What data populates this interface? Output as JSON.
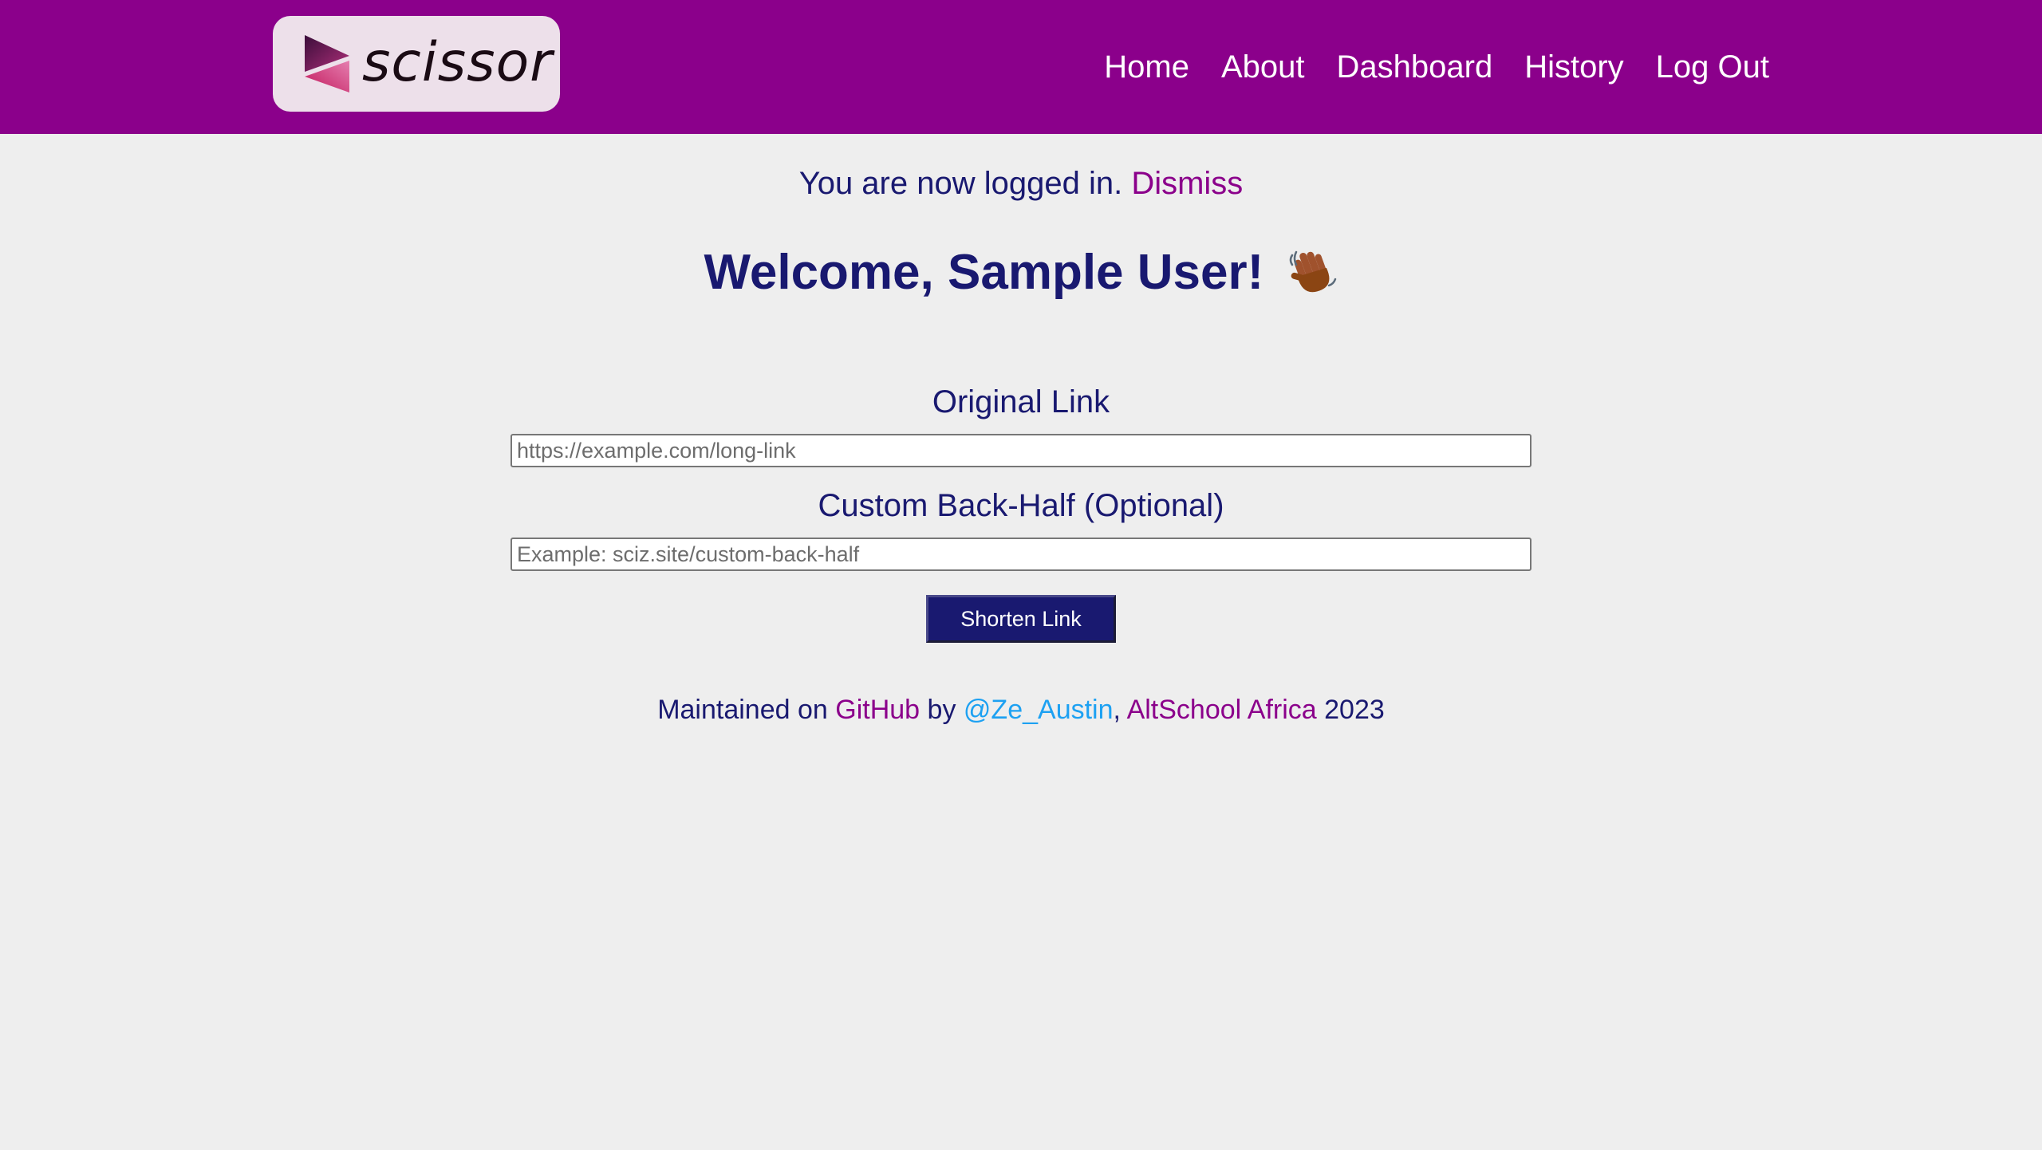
{
  "header": {
    "logo_text": "scissor",
    "nav": {
      "home": "Home",
      "about": "About",
      "dashboard": "Dashboard",
      "history": "History",
      "logout": "Log Out"
    }
  },
  "flash": {
    "message": "You are now logged in.",
    "dismiss": "Dismiss"
  },
  "welcome": {
    "heading": "Welcome, Sample User!",
    "emoji": "waving-hand-icon"
  },
  "form": {
    "original_label": "Original Link",
    "original_placeholder": "https://example.com/long-link",
    "original_value": "",
    "custom_label": "Custom Back-Half (Optional)",
    "custom_placeholder": "Example: sciz.site/custom-back-half",
    "custom_value": "",
    "submit_label": "Shorten Link"
  },
  "footer": {
    "prefix": "Maintained on",
    "github": "GitHub",
    "by": "by",
    "author": "@Ze_Austin",
    "comma": ",",
    "org": "AltSchool Africa",
    "year": "2023"
  },
  "colors": {
    "header_bg": "#8b008b",
    "text": "#191970",
    "link_purple": "#8b008b",
    "link_blue": "#1da1f2",
    "button_bg": "#191970",
    "page_bg": "#eeeeee"
  }
}
